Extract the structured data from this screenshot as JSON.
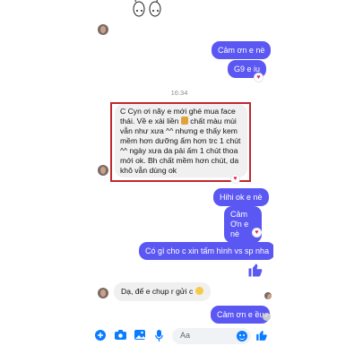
{
  "timestamp": "16:34",
  "messages": {
    "out_1": "Cảm ơn e nè",
    "out_2": "G9 e iu",
    "in_long": {
      "line1": "C Cyn ơi nãy e mới ghé mua face",
      "line2a": "thái. Về e xài liền",
      "line2b": "chất màu mùi",
      "line3": "vẫn như xưa ^^ nhưng e thấy kem",
      "line4": "mềm hơn dưỡng ẩm hơn trc 1 chút",
      "line5": "^^ ngày xưa da pải ấm 1 chút thoa",
      "line6": "mới ok. Bh chất mềm hơn chút, da",
      "line7": "khô vẫn dùng ok"
    },
    "out_3": "Hihi ok e nè",
    "out_4_line1": "Cảm",
    "out_4_line2": "Ơn e nè",
    "out_5": "Có gì cho c xin tấm hình vs sp nha",
    "in_short": "Dạ, để e chụp r gửi c",
    "out_6": "Cảm ơn e ều"
  },
  "composer": {
    "placeholder": "Aa"
  },
  "icons": {
    "heart": "heart-icon",
    "like": "thumbs-up-icon",
    "plus": "plus-icon",
    "camera": "camera-icon",
    "gallery": "image-icon",
    "mic": "microphone-icon",
    "emoji": "emoji-icon"
  },
  "colors": {
    "outgoing_bubble": "#5b57f2",
    "incoming_bubble": "#f0f0f0",
    "highlight_box": "#c0282d",
    "accent_blue": "#0a7cff"
  }
}
